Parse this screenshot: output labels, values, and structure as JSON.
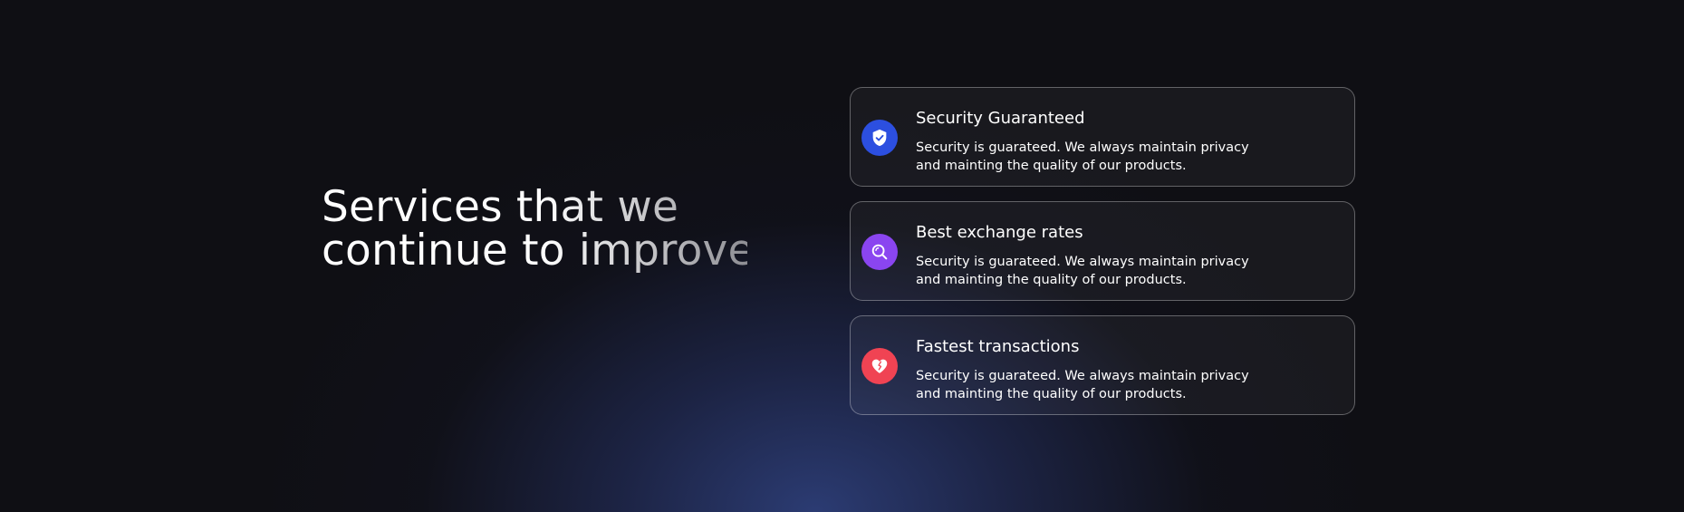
{
  "headline": {
    "line1": "Services that we",
    "line2": "continue to improve"
  },
  "features": [
    {
      "title": "Security Guaranteed",
      "description": "Security is guarateed. We always maintain privacy and mainting the quality of our products.",
      "icon": "shield-check-icon",
      "color": "#2c4fe0"
    },
    {
      "title": "Best exchange rates",
      "description": "Security is guarateed. We always maintain privacy and mainting the quality of our products.",
      "icon": "search-icon",
      "color": "#8a45f0"
    },
    {
      "title": "Fastest transactions",
      "description": "Security is guarateed. We always maintain privacy and mainting the quality of our products.",
      "icon": "heart-icon",
      "color": "#f04353"
    }
  ]
}
